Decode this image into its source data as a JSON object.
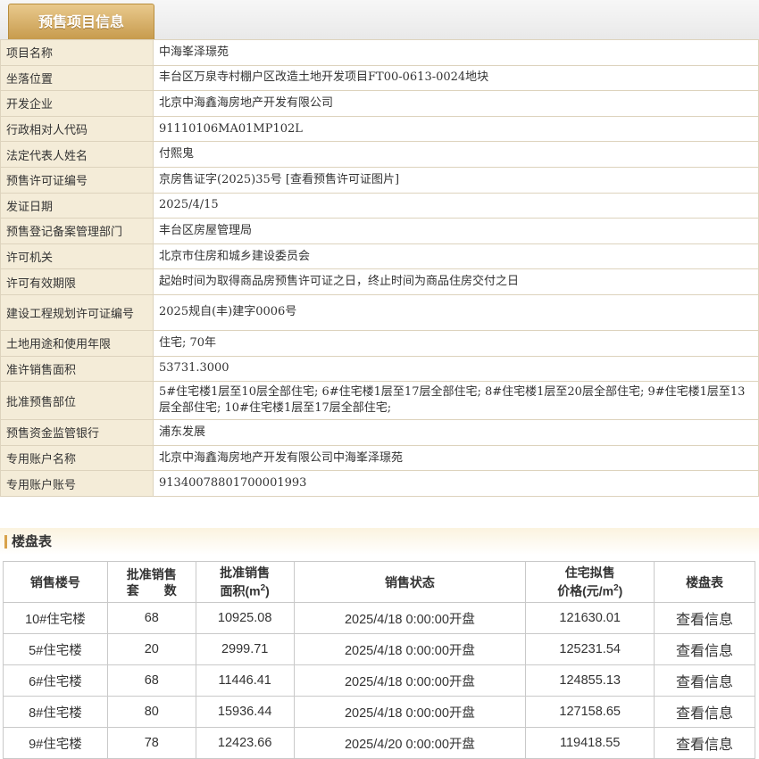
{
  "tab": {
    "label": "预售项目信息"
  },
  "info_rows": [
    {
      "label": "项目名称",
      "value": "中海峯泽璟苑"
    },
    {
      "label": "坐落位置",
      "value": "丰台区万泉寺村棚户区改造土地开发项目FT00-0613-0024地块"
    },
    {
      "label": "开发企业",
      "value": "北京中海鑫海房地产开发有限公司"
    },
    {
      "label": "行政相对人代码",
      "value": "91110106MA01MP102L"
    },
    {
      "label": "法定代表人姓名",
      "value": "付熙鬼"
    },
    {
      "label": "预售许可证编号",
      "value": "京房售证字(2025)35号",
      "link": "[查看预售许可证图片]"
    },
    {
      "label": "发证日期",
      "value": "2025/4/15"
    },
    {
      "label": "预售登记备案管理部门",
      "value": "丰台区房屋管理局"
    },
    {
      "label": "许可机关",
      "value": "北京市住房和城乡建设委员会"
    },
    {
      "label": "许可有效期限",
      "value": "起始时间为取得商品房预售许可证之日，终止时间为商品住房交付之日"
    },
    {
      "label": "建设工程规划许可证编号",
      "value": "2025规自(丰)建字0006号"
    },
    {
      "label": "土地用途和使用年限",
      "value": "住宅; 70年"
    },
    {
      "label": "准许销售面积",
      "value": "53731.3000"
    },
    {
      "label": "批准预售部位",
      "value": "5#住宅楼1层至10层全部住宅; 6#住宅楼1层至17层全部住宅; 8#住宅楼1层至20层全部住宅; 9#住宅楼1层至13层全部住宅; 10#住宅楼1层至17层全部住宅;"
    },
    {
      "label": "预售资金监管银行",
      "value": "浦东发展"
    },
    {
      "label": "专用账户名称",
      "value": "北京中海鑫海房地产开发有限公司中海峯泽璟苑"
    },
    {
      "label": "专用账户账号",
      "value": "91340078801700001993"
    }
  ],
  "loupan": {
    "title": "楼盘表",
    "headers": {
      "building": "销售楼号",
      "units_line1": "批准销售",
      "units_line2": "套　　数",
      "area_line1": "批准销售",
      "area_line2": "面积(m",
      "area_sup": "2",
      "area_end": ")",
      "status": "销售状态",
      "price_line1": "住宅拟售",
      "price_line2": "价格(元/m",
      "price_sup": "2",
      "price_end": ")",
      "table": "楼盘表"
    },
    "rows": [
      {
        "building": "10#住宅楼",
        "units": "68",
        "area": "10925.08",
        "status": "2025/4/18 0:00:00开盘",
        "price": "121630.01",
        "action": "查看信息"
      },
      {
        "building": "5#住宅楼",
        "units": "20",
        "area": "2999.71",
        "status": "2025/4/18 0:00:00开盘",
        "price": "125231.54",
        "action": "查看信息"
      },
      {
        "building": "6#住宅楼",
        "units": "68",
        "area": "11446.41",
        "status": "2025/4/18 0:00:00开盘",
        "price": "124855.13",
        "action": "查看信息"
      },
      {
        "building": "8#住宅楼",
        "units": "80",
        "area": "15936.44",
        "status": "2025/4/18 0:00:00开盘",
        "price": "127158.65",
        "action": "查看信息"
      },
      {
        "building": "9#住宅楼",
        "units": "78",
        "area": "12423.66",
        "status": "2025/4/20 0:00:00开盘",
        "price": "119418.55",
        "action": "查看信息"
      }
    ]
  }
}
